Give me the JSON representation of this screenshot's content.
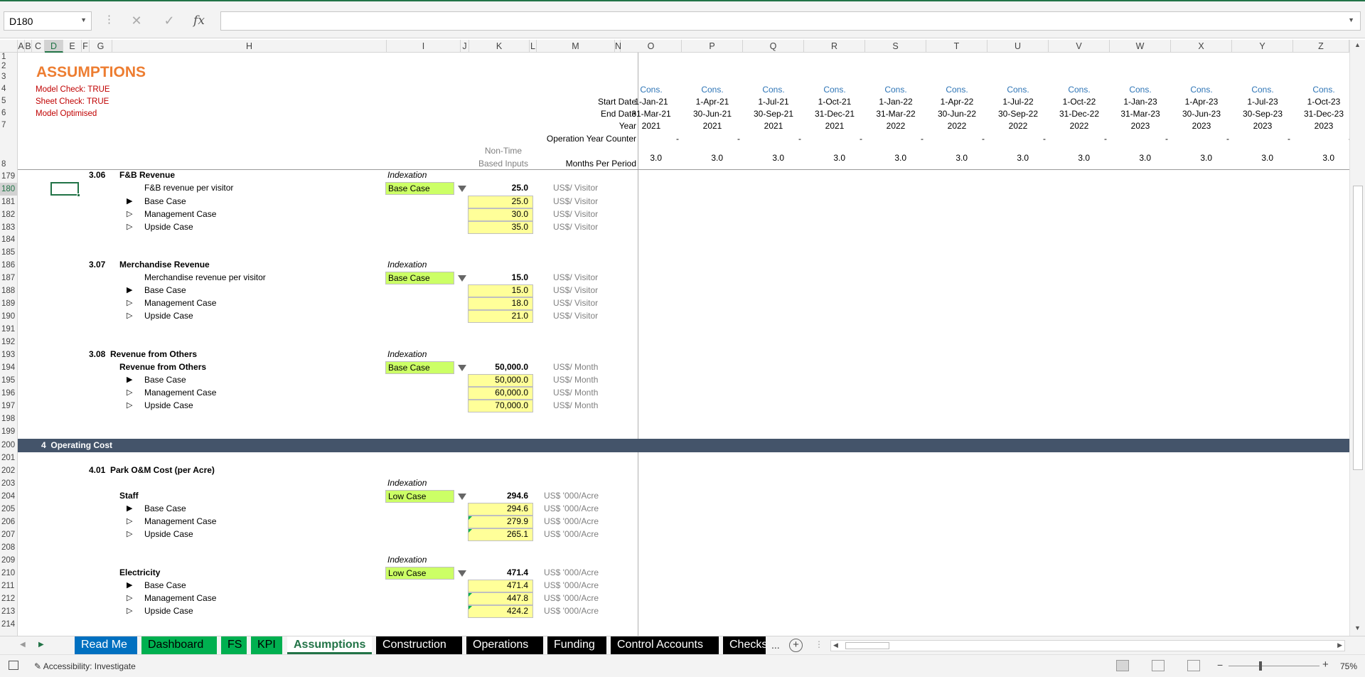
{
  "formula_bar": {
    "name_box": "D180",
    "formula": "",
    "fx_label": "fx",
    "cancel_symbol": "✕",
    "enter_symbol": "✓"
  },
  "columns": [
    "A",
    "B",
    "C",
    "D",
    "E",
    "F",
    "G",
    "H",
    "I",
    "J",
    "K",
    "L",
    "M",
    "N",
    "O",
    "P",
    "Q",
    "R",
    "S",
    "T",
    "U",
    "V",
    "W",
    "X",
    "Y",
    "Z"
  ],
  "selected_column": "D",
  "rows": [
    "1",
    "2",
    "3",
    "4",
    "5",
    "6",
    "7",
    "8",
    "179",
    "180",
    "181",
    "182",
    "183",
    "184",
    "185",
    "186",
    "187",
    "188",
    "189",
    "190",
    "191",
    "192",
    "193",
    "194",
    "195",
    "196",
    "197",
    "198",
    "199",
    "200",
    "201",
    "202",
    "203",
    "204",
    "205",
    "206",
    "207",
    "208",
    "209",
    "210",
    "211",
    "212",
    "213",
    "214"
  ],
  "selected_row": "180",
  "header": {
    "title": "ASSUMPTIONS",
    "checks": [
      "Model Check: TRUE",
      "Sheet Check: TRUE",
      "Model Optimised"
    ],
    "start_date_label": "Start Date",
    "end_date_label": "End Date",
    "year_label": "Year",
    "op_year_label": "Operation Year Counter",
    "non_time_1": "Non-Time",
    "non_time_2": "Based Inputs",
    "months_label": "Months Per Period"
  },
  "periods": [
    {
      "col": "O",
      "cons": "Cons.",
      "start": "1-Jan-21",
      "end": "31-Mar-21",
      "year": "2021",
      "op": "-",
      "months": "3.0"
    },
    {
      "col": "P",
      "cons": "Cons.",
      "start": "1-Apr-21",
      "end": "30-Jun-21",
      "year": "2021",
      "op": "-",
      "months": "3.0"
    },
    {
      "col": "Q",
      "cons": "Cons.",
      "start": "1-Jul-21",
      "end": "30-Sep-21",
      "year": "2021",
      "op": "-",
      "months": "3.0"
    },
    {
      "col": "R",
      "cons": "Cons.",
      "start": "1-Oct-21",
      "end": "31-Dec-21",
      "year": "2021",
      "op": "-",
      "months": "3.0"
    },
    {
      "col": "S",
      "cons": "Cons.",
      "start": "1-Jan-22",
      "end": "31-Mar-22",
      "year": "2022",
      "op": "-",
      "months": "3.0"
    },
    {
      "col": "T",
      "cons": "Cons.",
      "start": "1-Apr-22",
      "end": "30-Jun-22",
      "year": "2022",
      "op": "-",
      "months": "3.0"
    },
    {
      "col": "U",
      "cons": "Cons.",
      "start": "1-Jul-22",
      "end": "30-Sep-22",
      "year": "2022",
      "op": "-",
      "months": "3.0"
    },
    {
      "col": "V",
      "cons": "Cons.",
      "start": "1-Oct-22",
      "end": "31-Dec-22",
      "year": "2022",
      "op": "-",
      "months": "3.0"
    },
    {
      "col": "W",
      "cons": "Cons.",
      "start": "1-Jan-23",
      "end": "31-Mar-23",
      "year": "2023",
      "op": "-",
      "months": "3.0"
    },
    {
      "col": "X",
      "cons": "Cons.",
      "start": "1-Apr-23",
      "end": "30-Jun-23",
      "year": "2023",
      "op": "-",
      "months": "3.0"
    },
    {
      "col": "Y",
      "cons": "Cons.",
      "start": "1-Jul-23",
      "end": "30-Sep-23",
      "year": "2023",
      "op": "-",
      "months": "3.0"
    },
    {
      "col": "Z",
      "cons": "Cons.",
      "start": "1-Oct-23",
      "end": "31-Dec-23",
      "year": "2023",
      "op": "-",
      "months": "3.0"
    }
  ],
  "sections": {
    "fb": {
      "num": "3.06",
      "title": "F&B Revenue",
      "index_label": "Indexation",
      "item": "F&B revenue per visitor",
      "select": "Base Case",
      "value": "25.0",
      "unit": "US$/ Visitor",
      "cases": [
        {
          "name": "Base Case",
          "value": "25.0",
          "unit": "US$/ Visitor"
        },
        {
          "name": "Management Case",
          "value": "30.0",
          "unit": "US$/ Visitor"
        },
        {
          "name": "Upside Case",
          "value": "35.0",
          "unit": "US$/ Visitor"
        }
      ]
    },
    "merch": {
      "num": "3.07",
      "title": "Merchandise Revenue",
      "index_label": "Indexation",
      "item": "Merchandise revenue per visitor",
      "select": "Base Case",
      "value": "15.0",
      "unit": "US$/ Visitor",
      "cases": [
        {
          "name": "Base Case",
          "value": "15.0",
          "unit": "US$/ Visitor"
        },
        {
          "name": "Management Case",
          "value": "18.0",
          "unit": "US$/ Visitor"
        },
        {
          "name": "Upside Case",
          "value": "21.0",
          "unit": "US$/ Visitor"
        }
      ]
    },
    "others": {
      "num": "3.08",
      "title": "Revenue from Others",
      "index_label": "Indexation",
      "item": "Revenue from Others",
      "select": "Base Case",
      "value": "50,000.0",
      "unit": "US$/ Month",
      "cases": [
        {
          "name": "Base Case",
          "value": "50,000.0",
          "unit": "US$/ Month"
        },
        {
          "name": "Management Case",
          "value": "60,000.0",
          "unit": "US$/ Month"
        },
        {
          "name": "Upside Case",
          "value": "70,000.0",
          "unit": "US$/ Month"
        }
      ]
    },
    "opcost": {
      "num": "4",
      "title": "Operating Cost"
    },
    "park": {
      "num": "4.01",
      "title": "Park O&M Cost (per Acre)"
    },
    "staff": {
      "index_label": "Indexation",
      "item": "Staff",
      "select": "Low Case",
      "value": "294.6",
      "unit": "US$ '000/Acre",
      "cases": [
        {
          "name": "Base Case",
          "value": "294.6",
          "unit": "US$ '000/Acre"
        },
        {
          "name": "Management Case",
          "value": "279.9",
          "unit": "US$ '000/Acre"
        },
        {
          "name": "Upside Case",
          "value": "265.1",
          "unit": "US$ '000/Acre"
        }
      ]
    },
    "elec": {
      "index_label": "Indexation",
      "item": "Electricity",
      "select": "Low Case",
      "value": "471.4",
      "unit": "US$ '000/Acre",
      "cases": [
        {
          "name": "Base Case",
          "value": "471.4",
          "unit": "US$ '000/Acre"
        },
        {
          "name": "Management Case",
          "value": "447.8",
          "unit": "US$ '000/Acre"
        },
        {
          "name": "Upside Case",
          "value": "424.2",
          "unit": "US$ '000/Acre"
        }
      ]
    }
  },
  "tabs": [
    {
      "label": "Read Me",
      "color": "#0070c0"
    },
    {
      "label": "Dashboard",
      "color": "#00b050"
    },
    {
      "label": "FS",
      "color": "#00b050"
    },
    {
      "label": "KPI",
      "color": "#00b050"
    },
    {
      "label": "Assumptions",
      "color": "#ffffff",
      "active": true
    },
    {
      "label": "Construction",
      "color": "#000000"
    },
    {
      "label": "Operations",
      "color": "#000000"
    },
    {
      "label": "Funding",
      "color": "#000000"
    },
    {
      "label": "Control Accounts",
      "color": "#000000"
    },
    {
      "label": "Checks",
      "color": "#000000"
    }
  ],
  "tab_overflow": "...",
  "status": {
    "accessibility": "Accessibility: Investigate",
    "zoom": "75%"
  }
}
